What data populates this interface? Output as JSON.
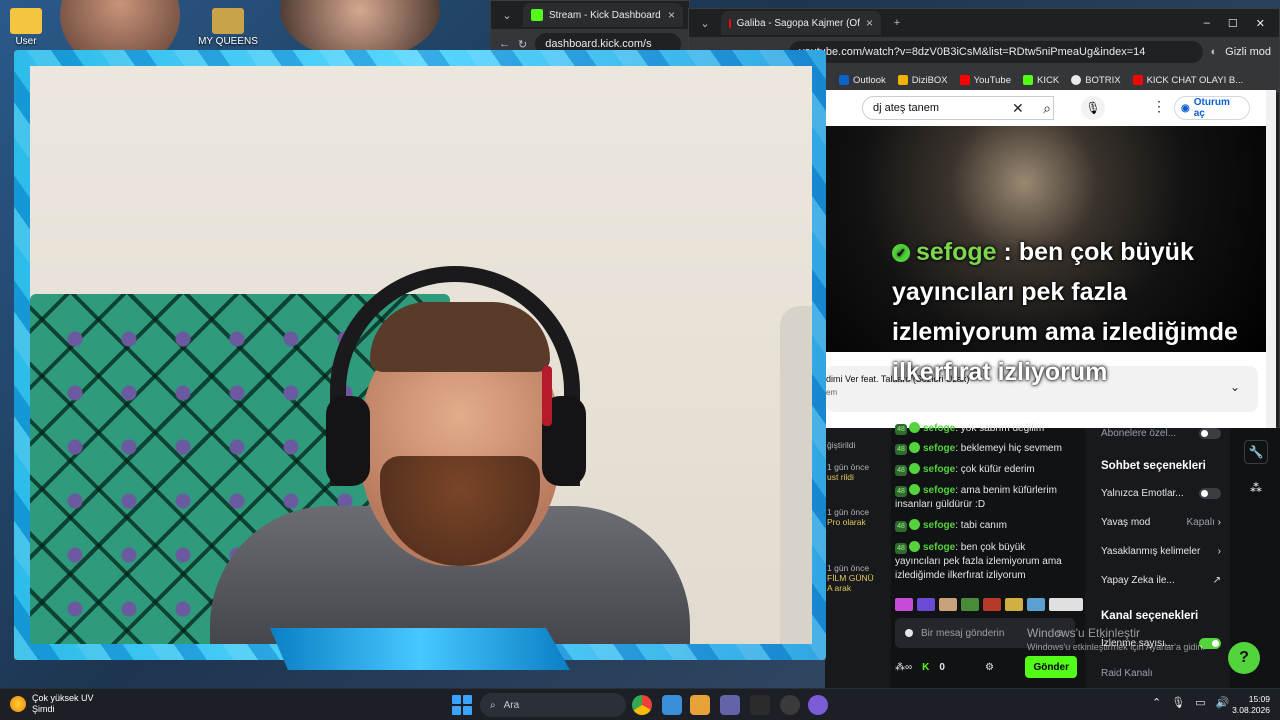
{
  "desktop": {
    "icons": [
      {
        "label": "User",
        "icon": "folder-icon"
      },
      {
        "label": "MY QUEENS",
        "icon": "folder-icon"
      }
    ]
  },
  "kick_window": {
    "tab_title": "Stream - Kick Dashboard",
    "url": "dashboard.kick.com/s"
  },
  "youtube_window": {
    "tab_title": "Galiba - Sagopa Kajmer (Of",
    "url": "youtube.com/watch?v=8dzV0B3iCsM&list=RDtw5niPmeaUg&index=14",
    "incognito_label": "Gizli mod",
    "bookmarks": [
      "Outlook",
      "DiziBOX",
      "YouTube",
      "KICK",
      "BOTRIX",
      "KICK CHAT OLAYI B..."
    ],
    "search_query": "dj ateş tanem",
    "login_label": "Oturum aç",
    "playlist_title": "dimi Ver feat. Talaaro (Sözleri Uzak)",
    "playlist_sub": "em"
  },
  "overlay": {
    "user": "sefoge",
    "text": ": ben çok büyük yayıncıları pek fazla izlemiyorum ama izlediğimde ilkerfırat izliyorum"
  },
  "kick_events": [
    {
      "time": "ğiştirildi",
      "text": ""
    },
    {
      "time": "1 gün önce",
      "text": "ust rildi"
    },
    {
      "time": "1 gün önce",
      "text": "Pro olarak"
    },
    {
      "time": "1 gün önce",
      "text": "FİLM GÜNÜ A arak"
    }
  ],
  "chat": {
    "messages": [
      {
        "level": "48",
        "user": "sefoge",
        "text": "yok sabrım değilim"
      },
      {
        "level": "48",
        "user": "sefoge",
        "text": "beklemeyi hiç sevmem"
      },
      {
        "level": "48",
        "user": "sefoge",
        "text": "çok küfür ederim"
      },
      {
        "level": "48",
        "user": "sefoge",
        "text": "ama benim küfürlerim insanları güldürür :D"
      },
      {
        "level": "48",
        "user": "sefoge",
        "text": "tabi canım"
      },
      {
        "level": "48",
        "user": "sefoge",
        "text": "ben çok büyük yayıncıları pek fazla izlemiyorum ama izlediğimde ilkerfırat izliyorum"
      }
    ],
    "input_placeholder": "Bir mesaj gönderin",
    "points": "0",
    "send_label": "Gönder"
  },
  "settings": {
    "subscribers_only": "Abonelere özel...",
    "chat_options_title": "Sohbet seçenekleri",
    "emotes_only": "Yalnızca Emotlar...",
    "slow_mode": "Yavaş mod",
    "slow_mode_value": "Kapalı",
    "banned_words": "Yasaklanmış kelimeler",
    "ai": "Yapay Zeka ile...",
    "channel_options_title": "Kanal seçenekleri",
    "viewer_count": "İzlenme sayısı...",
    "raid": "Raid Kanalı"
  },
  "watermark": {
    "title": "Windows'u Etkinleştir",
    "sub": "Windows'u etkinleştirmek için Ayarlar'a gidin."
  },
  "taskbar": {
    "weather_title": "Çok yüksek UV",
    "weather_sub": "Şimdi",
    "search_placeholder": "Ara",
    "time": "15:09",
    "date": "3.08.2026"
  }
}
